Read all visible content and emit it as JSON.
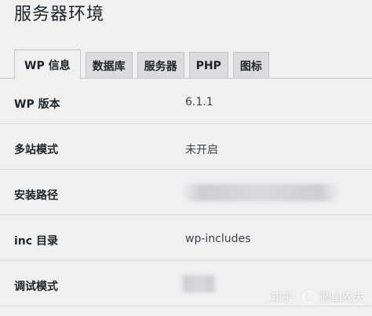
{
  "header": {
    "title": "服务器环境"
  },
  "tabs": [
    {
      "label": "WP 信息",
      "active": true
    },
    {
      "label": "数据库",
      "active": false
    },
    {
      "label": "服务器",
      "active": false
    },
    {
      "label": "PHP",
      "active": false
    },
    {
      "label": "图标",
      "active": false
    }
  ],
  "rows": [
    {
      "label": "WP 版本",
      "value": "6.1.1"
    },
    {
      "label": "多站模式",
      "value": "未开启"
    },
    {
      "label": "安装路径",
      "value": ""
    },
    {
      "label": "inc 目录",
      "value": "wp-includes"
    },
    {
      "label": "调试模式",
      "value": ""
    }
  ],
  "watermark": {
    "site": "知乎",
    "author": "圆山农夫"
  },
  "colors": {
    "background": "#f0f0f1",
    "tab_inactive": "#dcdcde",
    "border": "#c3c4c7",
    "text": "#1d2327"
  }
}
